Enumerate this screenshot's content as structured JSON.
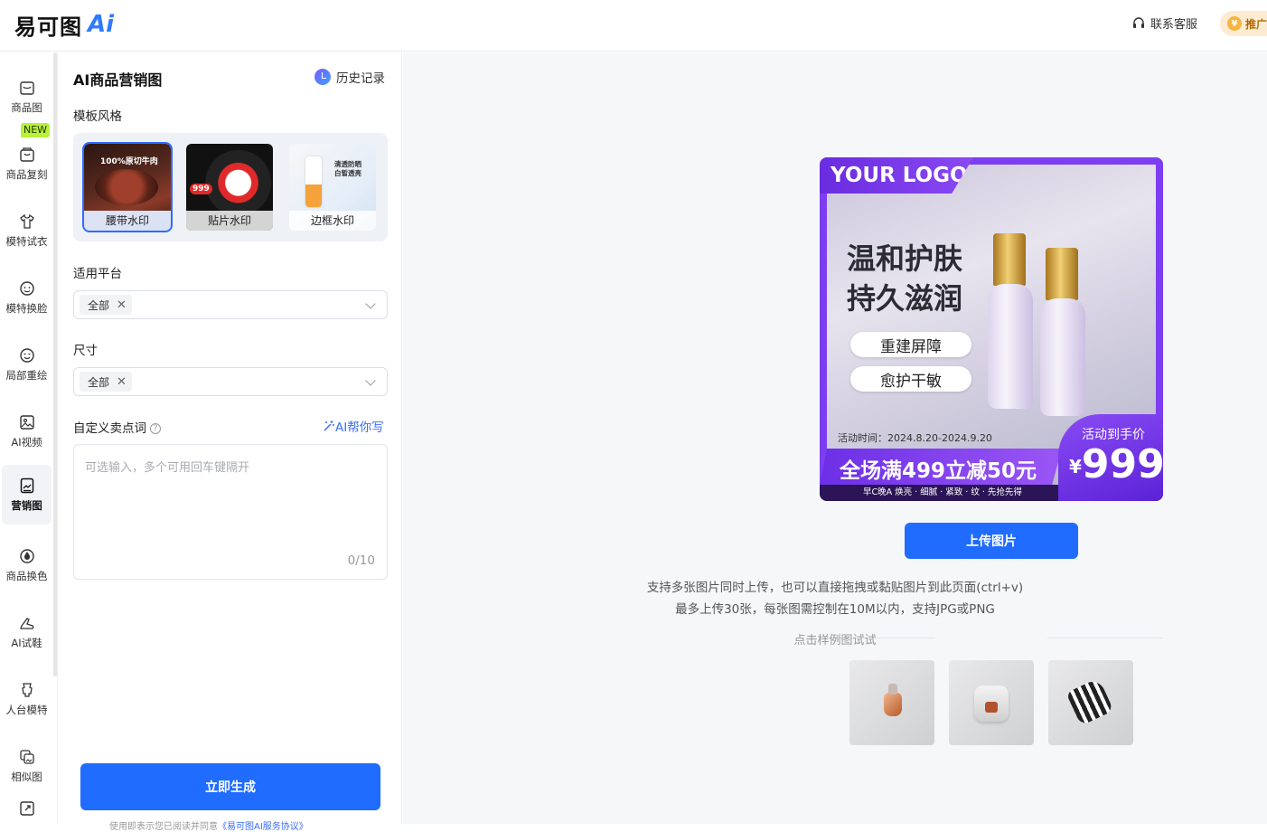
{
  "header": {
    "logo_text": "易可图",
    "logo_ai": "Ai",
    "service_label": "联系客服",
    "promo_label": "推广"
  },
  "sidebar": {
    "new_badge": "NEW",
    "items": [
      {
        "label": "商品图",
        "icon": "image-icon"
      },
      {
        "label": "商品复刻",
        "icon": "bag-icon"
      },
      {
        "label": "模特试衣",
        "icon": "shirt-icon"
      },
      {
        "label": "模特换脸",
        "icon": "face-icon"
      },
      {
        "label": "局部重绘",
        "icon": "smile-icon"
      },
      {
        "label": "AI视频",
        "icon": "video-icon"
      },
      {
        "label": "营销图",
        "icon": "poster-icon",
        "active": true
      },
      {
        "label": "商品换色",
        "icon": "drop-icon"
      },
      {
        "label": "AI试鞋",
        "icon": "shoe-icon"
      },
      {
        "label": "人台模特",
        "icon": "mannequin-icon"
      },
      {
        "label": "相似图",
        "icon": "similar-icon"
      }
    ]
  },
  "panel": {
    "title": "AI商品营销图",
    "history_label": "历史记录",
    "template_label": "模板风格",
    "templates": [
      {
        "caption": "腰带水印",
        "text": "100%原切牛肉",
        "selected": true
      },
      {
        "caption": "贴片水印",
        "text": "999"
      },
      {
        "caption": "边框水印",
        "text": "清透防晒 白皙透亮"
      }
    ],
    "platform_label": "适用平台",
    "platform_tag": "全部",
    "size_label": "尺寸",
    "size_tag": "全部",
    "selling_label": "自定义卖点词",
    "ai_write_label": "AI帮你写",
    "selling_placeholder": "可选输入，多个可用回车键隔开",
    "selling_count": "0/10",
    "generate_label": "立即生成",
    "footnote_prefix": "使用即表示您已阅读并同意",
    "footnote_link": "《易可图AI服务协议》"
  },
  "main": {
    "sample": {
      "logo": "YOUR LOGO",
      "headline_1": "温和护肤",
      "headline_2": "持久滋润",
      "pill_1": "重建屏障",
      "pill_2": "愈护干敏",
      "date": "活动时间：2024.8.20-2024.9.20",
      "promo": "全场满499立减50元",
      "subline": "早C晚A 焕亮 · 细腻 · 紧致 · 纹 · 先抢先得",
      "price_label": "活动到手价",
      "price_currency": "¥",
      "price_value": "999"
    },
    "upload_label": "上传图片",
    "hint_1": "支持多张图片同时上传，也可以直接拖拽或黏贴图片到此页面(ctrl+v)",
    "hint_2": "最多上传30张，每张图需控制在10M以内，支持JPG或PNG",
    "try_label": "点击样例图试试",
    "examples": [
      "perfume-bottle",
      "air-fryer",
      "gloves"
    ]
  },
  "colors": {
    "primary": "#1f6cff",
    "accent_purple": "#7c3ef0",
    "new_badge": "#b8f03a"
  }
}
